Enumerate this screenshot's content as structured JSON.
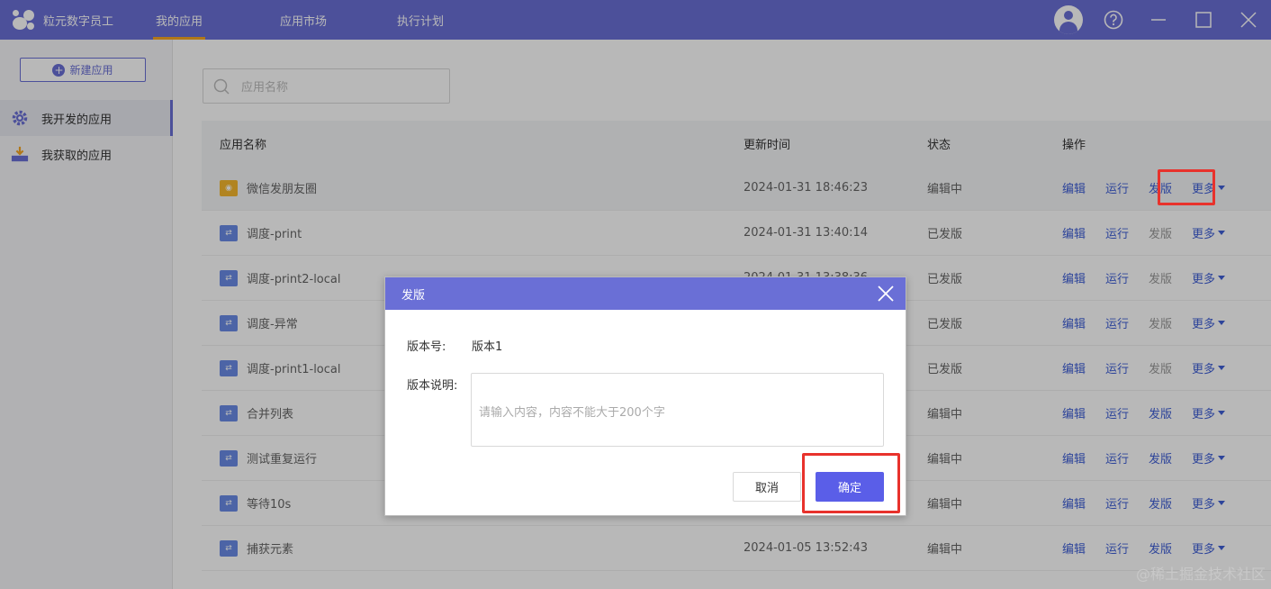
{
  "app": {
    "name": "粒元数字员工"
  },
  "topnav": {
    "items": [
      {
        "label": "我的应用"
      },
      {
        "label": "应用市场"
      },
      {
        "label": "执行计划"
      }
    ]
  },
  "sidebar": {
    "new_button": "新建应用",
    "items": [
      {
        "label": "我开发的应用"
      },
      {
        "label": "我获取的应用"
      }
    ]
  },
  "search": {
    "placeholder": "应用名称"
  },
  "table": {
    "headers": {
      "name": "应用名称",
      "time": "更新时间",
      "status": "状态",
      "ops": "操作"
    },
    "op_labels": {
      "edit": "编辑",
      "run": "运行",
      "publish": "发版",
      "more": "更多"
    },
    "rows": [
      {
        "name": "微信发朋友圈",
        "time": "2024-01-31 18:46:23",
        "status": "编辑中"
      },
      {
        "name": "调度-print",
        "time": "2024-01-31 13:40:14",
        "status": "已发版"
      },
      {
        "name": "调度-print2-local",
        "time": "2024-01-31 13:38:36",
        "status": "已发版"
      },
      {
        "name": "调度-异常",
        "time": "",
        "status": "已发版"
      },
      {
        "name": "调度-print1-local",
        "time": "",
        "status": "已发版"
      },
      {
        "name": "合并列表",
        "time": "",
        "status": "编辑中"
      },
      {
        "name": "测试重复运行",
        "time": "",
        "status": "编辑中"
      },
      {
        "name": "等待10s",
        "time": "",
        "status": "编辑中"
      },
      {
        "name": "捕获元素",
        "time": "2024-01-05 13:52:43",
        "status": "编辑中"
      }
    ]
  },
  "dialog": {
    "title": "发版",
    "version_label": "版本号:",
    "version_value": "版本1",
    "desc_label": "版本说明:",
    "desc_placeholder": "请输入内容，内容不能大于200个字",
    "cancel": "取消",
    "confirm": "确定"
  },
  "watermark": "@稀土掘金技术社区",
  "colors": {
    "brand": "#6a6fd6",
    "link": "#3f5fd6",
    "highlight": "#e8322c",
    "primary_button": "#5a5ee8"
  }
}
